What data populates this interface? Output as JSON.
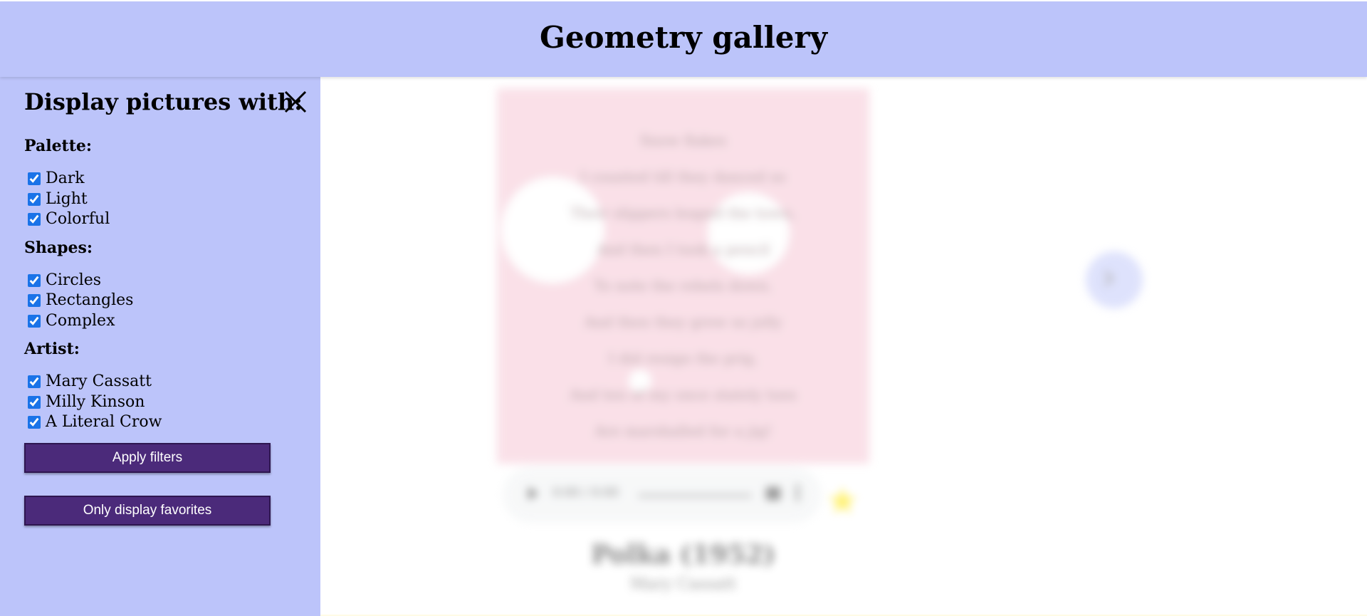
{
  "header": {
    "title": "Geometry gallery"
  },
  "sidebar": {
    "heading": "Display pictures with:",
    "palette": {
      "title": "Palette:",
      "options": [
        {
          "label": "Dark",
          "checked": true
        },
        {
          "label": "Light",
          "checked": true
        },
        {
          "label": "Colorful",
          "checked": true
        }
      ]
    },
    "shapes": {
      "title": "Shapes:",
      "options": [
        {
          "label": "Circles",
          "checked": true
        },
        {
          "label": "Rectangles",
          "checked": true
        },
        {
          "label": "Complex",
          "checked": true
        }
      ]
    },
    "artist": {
      "title": "Artist:",
      "options": [
        {
          "label": "Mary Cassatt",
          "checked": true
        },
        {
          "label": "Milly Kinson",
          "checked": true
        },
        {
          "label": "A Literal Crow",
          "checked": true
        }
      ]
    },
    "apply_label": "Apply filters",
    "favorites_label": "Only display favorites"
  },
  "gallery": {
    "poem": [
      "Snow flakes",
      "I counted till they danced so",
      "Their slippers leaped the town,",
      "And then I took a pencil",
      "To note the rebels down.",
      "And then they grew so jolly",
      "I did resign the prig,",
      "And ten of my once stately toes",
      "Are marshalled for a jig!"
    ],
    "audio_time": "0:00 / 0:00",
    "title": "Polka (1952)",
    "artist": "Mary Cassatt"
  },
  "colors": {
    "header_bg": "#bcc4fa",
    "button_bg": "#4b2a7a",
    "picture_bg": "#f6c8d6",
    "star": "#ffe600"
  }
}
